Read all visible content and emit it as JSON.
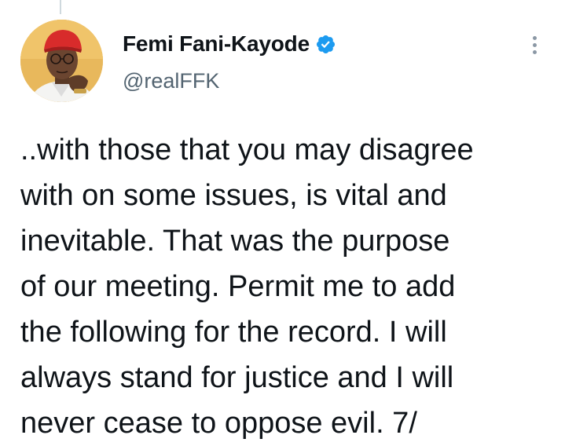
{
  "tweet": {
    "author": {
      "display_name": "Femi Fani-Kayode",
      "handle": "@realFFK",
      "verified": true,
      "avatar_icon": "profile-photo"
    },
    "text_lines": [
      "..with those that you may disagree",
      "with on some issues, is vital and",
      "inevitable. That was the purpose",
      "of our meeting. Permit me to add",
      "the following for the record. I will",
      "always stand for justice and I will",
      "never cease to oppose evil. 7/"
    ],
    "more_options_icon": "more-vertical-icon"
  },
  "colors": {
    "text_primary": "#0f1419",
    "text_secondary": "#536471",
    "verified_blue": "#1d9bf0",
    "thread_line": "#cfd9de"
  }
}
